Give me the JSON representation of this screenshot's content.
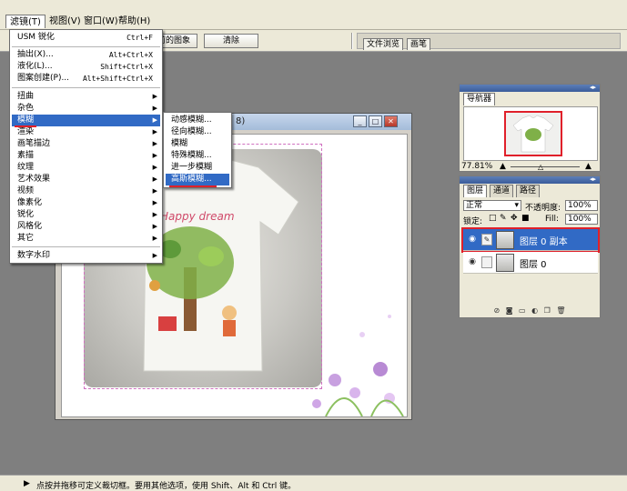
{
  "menubar": {
    "items": [
      {
        "label": "滤镜(T)"
      },
      {
        "label": "视图(V)"
      },
      {
        "label": "窗口(W)"
      },
      {
        "label": "帮助(H)"
      }
    ]
  },
  "options_bar": {
    "image_button_label": "前的图象",
    "clear_button_label": "清除",
    "tab_file_browser": "文件浏览",
    "tab_brushes": "画笔"
  },
  "filter_menu": {
    "items": [
      {
        "label": "USM 锐化",
        "shortcut": "Ctrl+F"
      },
      {
        "label": "抽出(X)...",
        "shortcut": "Alt+Ctrl+X"
      },
      {
        "label": "液化(L)...",
        "shortcut": "Shift+Ctrl+X"
      },
      {
        "label": "图案创建(P)...",
        "shortcut": "Alt+Shift+Ctrl+X"
      },
      {
        "label": "扭曲"
      },
      {
        "label": "杂色"
      },
      {
        "label": "模糊"
      },
      {
        "label": "渲染"
      },
      {
        "label": "画笔描边"
      },
      {
        "label": "素描"
      },
      {
        "label": "纹理"
      },
      {
        "label": "艺术效果"
      },
      {
        "label": "视频"
      },
      {
        "label": "像素化"
      },
      {
        "label": "锐化"
      },
      {
        "label": "风格化"
      },
      {
        "label": "其它"
      },
      {
        "label": "数字水印"
      }
    ]
  },
  "blur_submenu": {
    "items": [
      {
        "label": "动感模糊..."
      },
      {
        "label": "径向模糊..."
      },
      {
        "label": "模糊"
      },
      {
        "label": "特殊模糊..."
      },
      {
        "label": "进一步模糊"
      },
      {
        "label": "高斯模糊..."
      }
    ]
  },
  "document": {
    "title_suffix": "8)"
  },
  "navigator": {
    "tab_label": "导航器",
    "zoom": "77.81%"
  },
  "layers": {
    "tabs": [
      {
        "label": "图层"
      },
      {
        "label": "通道"
      },
      {
        "label": "路径"
      }
    ],
    "blend_mode": "正常",
    "opacity_label": "不透明度:",
    "opacity_value": "100%",
    "lock_label": "锁定:",
    "fill_label": "Fill:",
    "fill_value": "100%",
    "items": [
      {
        "name": "图层 0 副本",
        "selected": true
      },
      {
        "name": "图层 0",
        "selected": false
      }
    ]
  },
  "status": {
    "text": "点按并拖移可定义裁切框。要用其他选项，使用 Shift、Alt 和 Ctrl 键。"
  },
  "colors": {
    "highlight": "#316ac5",
    "annotation_red": "#e0202a"
  }
}
